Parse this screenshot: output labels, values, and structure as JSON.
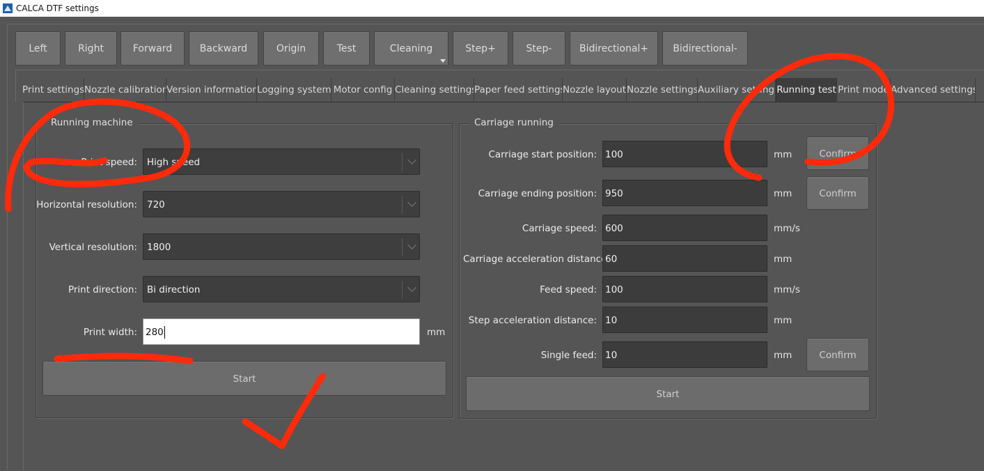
{
  "window": {
    "title": "CALCA DTF settings"
  },
  "toolbar": {
    "buttons": [
      "Left",
      "Right",
      "Forward",
      "Backward",
      "Origin",
      "Test",
      "Cleaning",
      "Step+",
      "Step-",
      "Bidirectional+",
      "Bidirectional-"
    ]
  },
  "tabs": [
    "Print settings",
    "Nozzle calibration",
    "Version information",
    "Logging system",
    "Motor config",
    "Cleaning settings",
    "Paper feed settings",
    "Nozzle layout",
    "Nozzle settings",
    "Auxiliary settings",
    "Running test",
    "Print mode",
    "Advanced settings"
  ],
  "active_tab": "Running test",
  "running_machine": {
    "title": "Running machine",
    "print_speed_label": "Print speed:",
    "print_speed_value": "High speed",
    "horizontal_resolution_label": "Horizontal resolution:",
    "horizontal_resolution_value": "720",
    "vertical_resolution_label": "Vertical resolution:",
    "vertical_resolution_value": "1800",
    "print_direction_label": "Print direction:",
    "print_direction_value": "Bi direction",
    "print_width_label": "Print width:",
    "print_width_value": "280",
    "print_width_unit": "mm",
    "start_label": "Start"
  },
  "carriage_running": {
    "title": "Carriage running",
    "fields": [
      {
        "label": "Carriage start position:",
        "value": "100",
        "unit": "mm"
      },
      {
        "label": "Carriage ending position:",
        "value": "950",
        "unit": "mm"
      },
      {
        "label": "Carriage speed:",
        "value": "600",
        "unit": "mm/s"
      },
      {
        "label": "Carriage acceleration distance",
        "value": "60",
        "unit": "mm"
      },
      {
        "label": "Feed speed:",
        "value": "100",
        "unit": "mm/s"
      },
      {
        "label": "Step acceleration distance:",
        "value": "10",
        "unit": "mm"
      },
      {
        "label": "Single feed:",
        "value": "10",
        "unit": "mm"
      }
    ],
    "confirm_label": "Confirm",
    "start_label": "Start"
  },
  "colors": {
    "background": "#555555",
    "annotation": "#ff2a0a"
  }
}
